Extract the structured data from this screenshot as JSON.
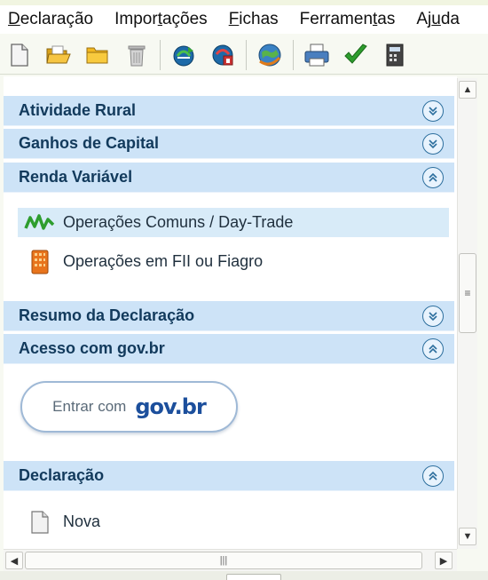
{
  "menu": {
    "items": [
      {
        "pre": "",
        "acc": "D",
        "post": "eclaração"
      },
      {
        "pre": "Impor",
        "acc": "t",
        "post": "ações"
      },
      {
        "pre": "",
        "acc": "F",
        "post": "ichas"
      },
      {
        "pre": "Ferramen",
        "acc": "t",
        "post": "as"
      },
      {
        "pre": "Aj",
        "acc": "u",
        "post": "da"
      }
    ]
  },
  "sections": {
    "atividade_rural": {
      "title": "Atividade Rural",
      "expanded": false
    },
    "ganhos_capital": {
      "title": "Ganhos de Capital",
      "expanded": false
    },
    "renda_variavel": {
      "title": "Renda Variável",
      "expanded": true,
      "items": [
        {
          "label": "Operações Comuns / Day-Trade",
          "icon": "chart-line-icon",
          "selected": true
        },
        {
          "label": "Operações em FII ou Fiagro",
          "icon": "building-icon",
          "selected": false
        }
      ]
    },
    "resumo": {
      "title": "Resumo da Declaração",
      "expanded": false
    },
    "acesso_govbr": {
      "title": "Acesso com gov.br",
      "expanded": true,
      "button_text": "Entrar com",
      "button_logo": "gov.br"
    },
    "declaracao": {
      "title": "Declaração",
      "expanded": true,
      "items": [
        {
          "label": "Nova",
          "icon": "document-icon"
        }
      ]
    }
  },
  "colors": {
    "section_header_bg": "#cde3f7",
    "section_title": "#123a5c",
    "selected_row_bg": "#d8ebf8",
    "govbr_blue": "#1c4f9c",
    "check_green": "#2e9d2e"
  },
  "toolbar": {
    "buttons": [
      "new-document-icon",
      "open-folder-icon",
      "folder-icon",
      "trash-icon",
      "receitanet-transmit-icon",
      "receitanet-recover-icon",
      "globe-update-icon",
      "print-icon",
      "check-icon",
      "calculator-icon"
    ]
  }
}
